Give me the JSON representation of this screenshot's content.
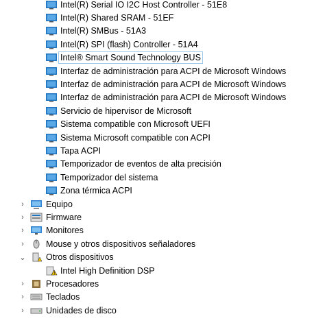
{
  "system_devices": [
    {
      "label": "Intel(R) Serial IO I2C Host Controller - 51E8"
    },
    {
      "label": "Intel(R) Shared SRAM - 51EF"
    },
    {
      "label": "Intel(R) SMBus - 51A3"
    },
    {
      "label": "Intel(R) SPI (flash) Controller - 51A4"
    },
    {
      "label": "Intel® Smart Sound Technology BUS",
      "selected": true
    },
    {
      "label": "Interfaz de administración para ACPI de Microsoft Windows"
    },
    {
      "label": "Interfaz de administración para ACPI de Microsoft Windows"
    },
    {
      "label": "Interfaz de administración para ACPI de Microsoft Windows"
    },
    {
      "label": "Servicio de hipervisor de Microsoft"
    },
    {
      "label": "Sistema compatible con Microsoft UEFI"
    },
    {
      "label": "Sistema Microsoft compatible con ACPI"
    },
    {
      "label": "Tapa ACPI"
    },
    {
      "label": "Temporizador de eventos de alta precisión"
    },
    {
      "label": "Temporizador del sistema"
    },
    {
      "label": "Zona térmica ACPI"
    }
  ],
  "categories": [
    {
      "label": "Equipo",
      "icon": "computer-icon",
      "expanded": false
    },
    {
      "label": "Firmware",
      "icon": "firmware-icon",
      "expanded": false
    },
    {
      "label": "Monitores",
      "icon": "monitor-icon",
      "expanded": false
    },
    {
      "label": "Mouse y otros dispositivos señaladores",
      "icon": "mouse-icon",
      "expanded": false
    },
    {
      "label": "Otros dispositivos",
      "icon": "unknown-device-icon",
      "expanded": true
    },
    {
      "label": "Intel High Definition DSP",
      "icon": "warning-device-icon",
      "child": true
    },
    {
      "label": "Procesadores",
      "icon": "processor-icon",
      "expanded": false
    },
    {
      "label": "Teclados",
      "icon": "keyboard-icon",
      "expanded": false
    },
    {
      "label": "Unidades de disco",
      "icon": "disk-drive-icon",
      "expanded": false
    }
  ],
  "colors": {
    "selection_border": "#99c9ef",
    "device_icon_blue": "#1e73be",
    "warning_yellow": "#f2c200"
  },
  "icons": {
    "collapsed": "›",
    "expanded": "⌄"
  }
}
